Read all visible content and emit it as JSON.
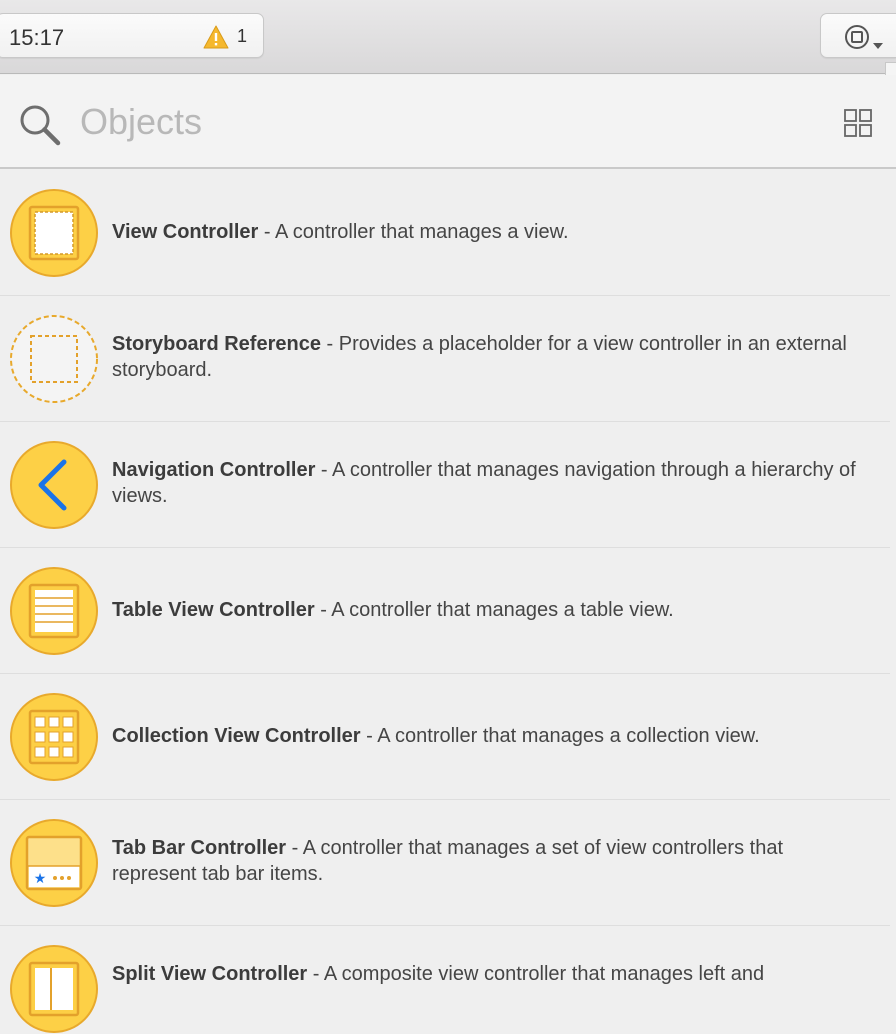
{
  "toolbar": {
    "status_time": "15:17",
    "warning_count": "1"
  },
  "search": {
    "placeholder": "Objects",
    "value": ""
  },
  "objects": [
    {
      "title": "View Controller",
      "description": " - A controller that manages a view."
    },
    {
      "title": "Storyboard Reference",
      "description": " - Provides a placeholder for a view controller in an external storyboard."
    },
    {
      "title": "Navigation Controller",
      "description": " - A controller that manages navigation through a hierarchy of views."
    },
    {
      "title": "Table View Controller",
      "description": " - A controller that manages a table view."
    },
    {
      "title": "Collection View Controller",
      "description": " - A controller that manages a collection view."
    },
    {
      "title": "Tab Bar Controller",
      "description": " - A controller that manages a set of view controllers that represent tab bar items."
    },
    {
      "title": "Split View Controller",
      "description": " - A composite view controller that manages left and"
    }
  ],
  "colors": {
    "icon_fill": "#fdd046",
    "icon_stroke": "#e8a92c",
    "accent_blue": "#1a73e8"
  }
}
